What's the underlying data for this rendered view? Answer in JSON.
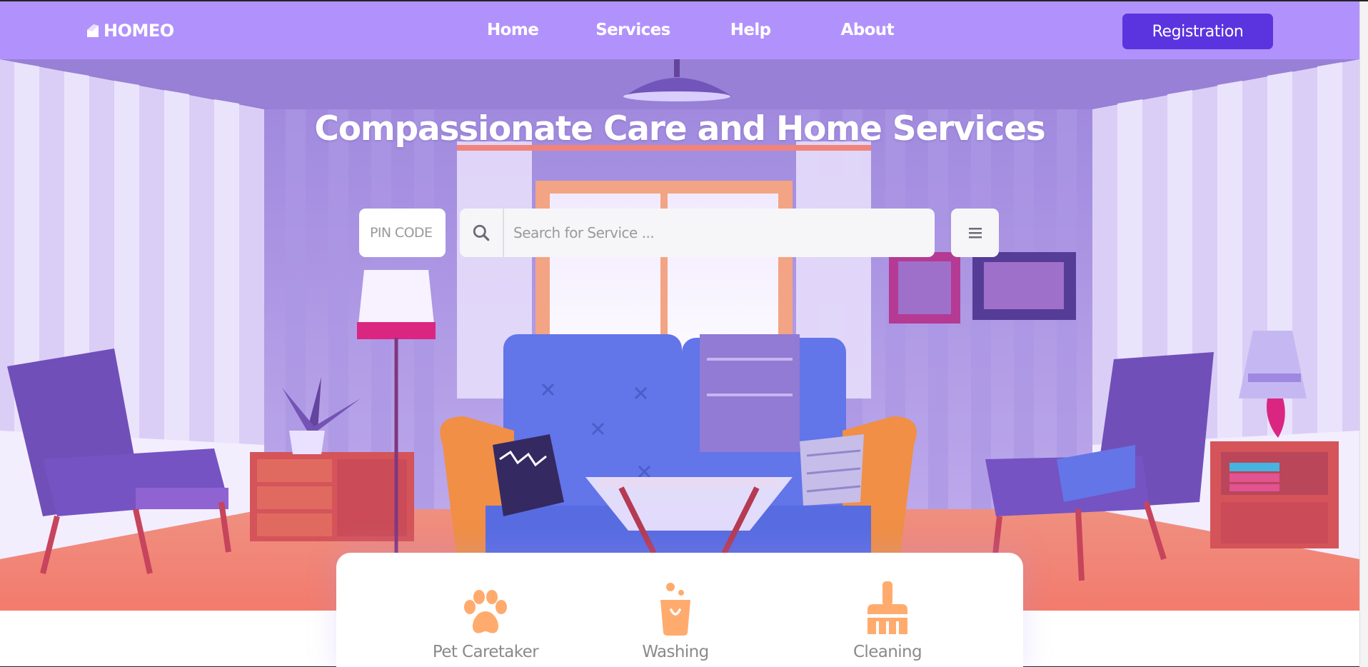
{
  "brand": {
    "name": "HOMEO",
    "icon": "house-icon"
  },
  "nav": {
    "items": [
      {
        "label": "Home"
      },
      {
        "label": "Services"
      },
      {
        "label": "Help"
      },
      {
        "label": "About"
      }
    ],
    "cta_label": "Registration"
  },
  "hero": {
    "title": "Compassionate Care and Home Services",
    "pin_placeholder": "PIN CODE",
    "search_placeholder": "Search for Service ...",
    "search_icon": "search-icon",
    "menu_icon": "hamburger-icon"
  },
  "services": [
    {
      "label": "Pet Caretaker",
      "icon": "paw-icon"
    },
    {
      "label": "Washing",
      "icon": "bucket-icon"
    },
    {
      "label": "Cleaning",
      "icon": "brush-icon"
    }
  ],
  "colors": {
    "nav_bg": "#b192fc",
    "cta_bg": "#5b34e0",
    "service_icon": "#ffab6e"
  }
}
